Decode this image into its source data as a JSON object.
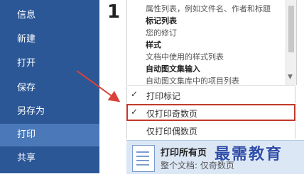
{
  "nav": {
    "items": [
      {
        "label": "信息",
        "active": false
      },
      {
        "label": "新建",
        "active": false
      },
      {
        "label": "打开",
        "active": false
      },
      {
        "label": "保存",
        "active": false
      },
      {
        "label": "另存为",
        "active": false
      },
      {
        "label": "打印",
        "active": true
      },
      {
        "label": "共享",
        "active": false
      }
    ]
  },
  "content": {
    "big_glyph": "1"
  },
  "dropdown": {
    "lines": [
      {
        "text": "属性列表，例如文件名、作者和标题",
        "bold": false
      },
      {
        "text": "标记列表",
        "bold": true
      },
      {
        "text": "您的修订",
        "bold": false
      },
      {
        "text": "样式",
        "bold": true
      },
      {
        "text": "文档中使用的样式列表",
        "bold": false
      },
      {
        "text": "自动图文集输入",
        "bold": true
      },
      {
        "text": "自动图文集库中的项目列表",
        "bold": false
      }
    ]
  },
  "options": [
    {
      "check": "✓",
      "label": "打印标记",
      "highlight": false
    },
    {
      "check": "✓",
      "label": "仅打印奇数页",
      "highlight": true
    },
    {
      "check": "",
      "label": "仅打印偶数页",
      "highlight": false
    }
  ],
  "print_selector": {
    "title": "打印所有页",
    "subtitle": "整个文档: 仅奇数页"
  },
  "watermark": "最需教育",
  "colors": {
    "nav_bg": "#2b5797",
    "nav_active": "#4a78b8",
    "highlight_border": "#c0392b",
    "selector_bg": "#dce7f5",
    "watermark": "#2e4da8"
  }
}
